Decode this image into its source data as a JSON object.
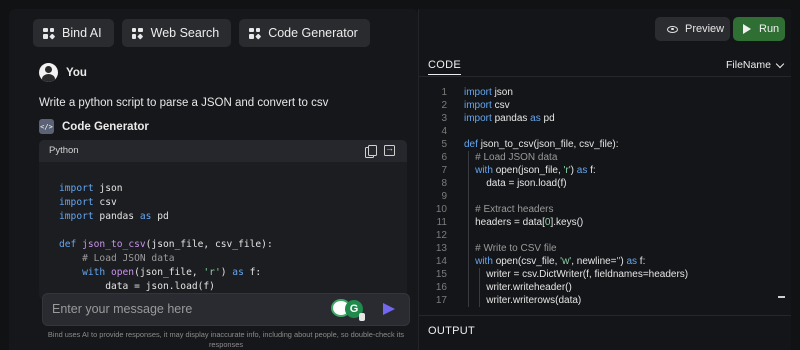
{
  "top_buttons": [
    {
      "label": "Bind AI"
    },
    {
      "label": "Web Search"
    },
    {
      "label": "Code Generator"
    }
  ],
  "chat": {
    "user_name": "You",
    "prompt": "Write a python script to parse a JSON and convert to csv",
    "assistant_name": "Code Generator",
    "code_language": "Python",
    "code_snippet": [
      [
        {
          "t": "import",
          "c": "kw"
        },
        {
          "t": " json",
          "c": ""
        }
      ],
      [
        {
          "t": "import",
          "c": "kw"
        },
        {
          "t": " csv",
          "c": ""
        }
      ],
      [
        {
          "t": "import",
          "c": "kw"
        },
        {
          "t": " pandas ",
          "c": ""
        },
        {
          "t": "as",
          "c": "kw"
        },
        {
          "t": " pd",
          "c": ""
        }
      ],
      [
        {
          "t": "",
          "c": ""
        }
      ],
      [
        {
          "t": "def ",
          "c": "kw"
        },
        {
          "t": "json_to_csv",
          "c": "fn"
        },
        {
          "t": "(json_file, csv_file):",
          "c": ""
        }
      ],
      [
        {
          "t": "    # Load JSON data",
          "c": "cm"
        }
      ],
      [
        {
          "t": "    with ",
          "c": "kw"
        },
        {
          "t": "open",
          "c": "fn"
        },
        {
          "t": "(json_file, ",
          "c": ""
        },
        {
          "t": "'r'",
          "c": "str"
        },
        {
          "t": ") ",
          "c": ""
        },
        {
          "t": "as",
          "c": "kw"
        },
        {
          "t": " f:",
          "c": ""
        }
      ],
      [
        {
          "t": "        data = json.load(f)",
          "c": ""
        }
      ]
    ]
  },
  "input": {
    "placeholder": "Enter your message here"
  },
  "disclaimer": "Bind uses AI to provide responses, it may display inaccurate info, including about people, so double-check its responses",
  "editor": {
    "preview_label": "Preview",
    "run_label": "Run",
    "code_tab_label": "CODE",
    "filename_label": "FileName",
    "output_label": "OUTPUT",
    "line_numbers": [
      "1",
      "2",
      "3",
      "4",
      "5",
      "6",
      "7",
      "8",
      "9",
      "10",
      "11",
      "12",
      "13",
      "14",
      "15",
      "16",
      "17"
    ],
    "lines": [
      [
        {
          "t": "import",
          "c": "kw"
        },
        {
          "t": " json",
          "c": ""
        }
      ],
      [
        {
          "t": "import",
          "c": "kw"
        },
        {
          "t": " csv",
          "c": ""
        }
      ],
      [
        {
          "t": "import",
          "c": "kw"
        },
        {
          "t": " pandas ",
          "c": ""
        },
        {
          "t": "as",
          "c": "kw"
        },
        {
          "t": " pd",
          "c": ""
        }
      ],
      [
        {
          "t": "",
          "c": ""
        }
      ],
      [
        {
          "t": "def ",
          "c": "kw"
        },
        {
          "t": "json_to_csv(json_file, csv_file):",
          "c": ""
        }
      ],
      [
        {
          "t": "    # Load JSON data",
          "c": "cm"
        }
      ],
      [
        {
          "t": "    with ",
          "c": "kw"
        },
        {
          "t": "open(json_file, ",
          "c": ""
        },
        {
          "t": "'r'",
          "c": "str"
        },
        {
          "t": ") ",
          "c": ""
        },
        {
          "t": "as",
          "c": "kw"
        },
        {
          "t": " f:",
          "c": ""
        }
      ],
      [
        {
          "t": "        data = json.load(f)",
          "c": ""
        }
      ],
      [
        {
          "t": "",
          "c": ""
        }
      ],
      [
        {
          "t": "    # Extract headers",
          "c": "cm"
        }
      ],
      [
        {
          "t": "    headers = data[",
          "c": ""
        },
        {
          "t": "0",
          "c": "str"
        },
        {
          "t": "].keys()",
          "c": ""
        }
      ],
      [
        {
          "t": "",
          "c": ""
        }
      ],
      [
        {
          "t": "    # Write to CSV file",
          "c": "cm"
        }
      ],
      [
        {
          "t": "    with ",
          "c": "kw"
        },
        {
          "t": "open(csv_file, ",
          "c": ""
        },
        {
          "t": "'w'",
          "c": "str"
        },
        {
          "t": ", newline=",
          "c": ""
        },
        {
          "t": "''",
          "c": "str"
        },
        {
          "t": ") ",
          "c": ""
        },
        {
          "t": "as",
          "c": "kw"
        },
        {
          "t": " f:",
          "c": ""
        }
      ],
      [
        {
          "t": "        writer = csv.DictWriter(f, fieldnames=headers)",
          "c": ""
        }
      ],
      [
        {
          "t": "        writer.writeheader()",
          "c": ""
        }
      ],
      [
        {
          "t": "        writer.writerows(data)",
          "c": ""
        }
      ]
    ]
  },
  "colors": {
    "keyword": "#64a6f0",
    "comment": "#9a9a9a",
    "string": "#8fd3a7",
    "run_button": "#2f6f33",
    "send_icon": "#7367f0"
  },
  "icons": [
    "grid-icon",
    "avatar",
    "code-icon",
    "copy-icon",
    "export-icon",
    "grammar-extension-icon",
    "send-icon",
    "eye-icon",
    "play-icon",
    "chevron-down-icon"
  ]
}
